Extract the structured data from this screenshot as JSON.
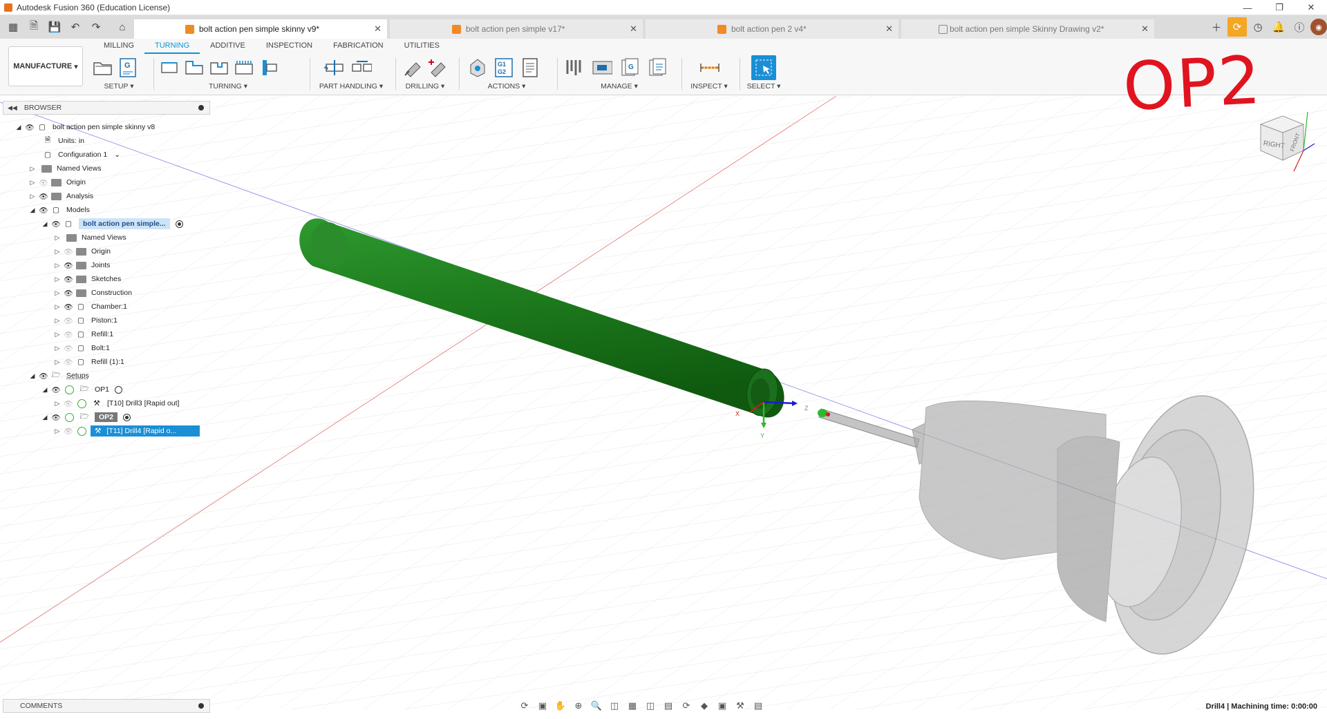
{
  "window": {
    "title": "Autodesk Fusion 360 (Education License)"
  },
  "tabs": [
    {
      "label": "bolt action pen simple skinny v9*",
      "active": true,
      "icon": "part-icon"
    },
    {
      "label": "bolt action pen simple v17*",
      "active": false,
      "icon": "part-icon"
    },
    {
      "label": "bolt action pen 2 v4*",
      "active": false,
      "icon": "part-icon"
    },
    {
      "label": "bolt action pen simple Skinny Drawing v2*",
      "active": false,
      "icon": "drawing-icon"
    }
  ],
  "ribbon": {
    "workspace": "MANUFACTURE",
    "tabs": [
      "MILLING",
      "TURNING",
      "ADDITIVE",
      "INSPECTION",
      "FABRICATION",
      "UTILITIES"
    ],
    "active_tab": "TURNING",
    "groups": {
      "setup": "SETUP",
      "turning": "TURNING",
      "part_handling": "PART HANDLING",
      "drilling": "DRILLING",
      "actions": "ACTIONS",
      "manage": "MANAGE",
      "inspect": "INSPECT",
      "select": "SELECT"
    },
    "g_code_label": "G1 G2",
    "g_label": "G"
  },
  "browser": {
    "header": "BROWSER",
    "items": {
      "root": "bolt action pen simple skinny v8",
      "units": "Units: in",
      "configuration": "Configuration 1",
      "named_views": "Named Views",
      "origin": "Origin",
      "analysis": "Analysis",
      "models": "Models",
      "model_component": "bolt action pen simple...",
      "named_views_2": "Named Views",
      "origin_2": "Origin",
      "joints": "Joints",
      "sketches": "Sketches",
      "construction": "Construction",
      "chamber": "Chamber:1",
      "piston": "Piston:1",
      "refill": "Refill:1",
      "bolt": "Bolt:1",
      "refill2": "Refill (1):1",
      "setups": "Setups",
      "op1": "OP1",
      "op1_drill": "[T10] Drill3 [Rapid out]",
      "op2": "OP2",
      "op2_drill": "[T11] Drill4 [Rapid o..."
    }
  },
  "viewport": {
    "annotation": "OP2",
    "viewcube_right": "RIGHT",
    "viewcube_front": "FRONT",
    "axis_y": "Y",
    "axis_z": "Z",
    "axis_x": "X",
    "part_color": "#1e7d1e",
    "chuck_color": "#9a9a9a"
  },
  "comments": {
    "label": "COMMENTS"
  },
  "status": {
    "text": "Drill4 | Machining time: 0:00:00"
  }
}
